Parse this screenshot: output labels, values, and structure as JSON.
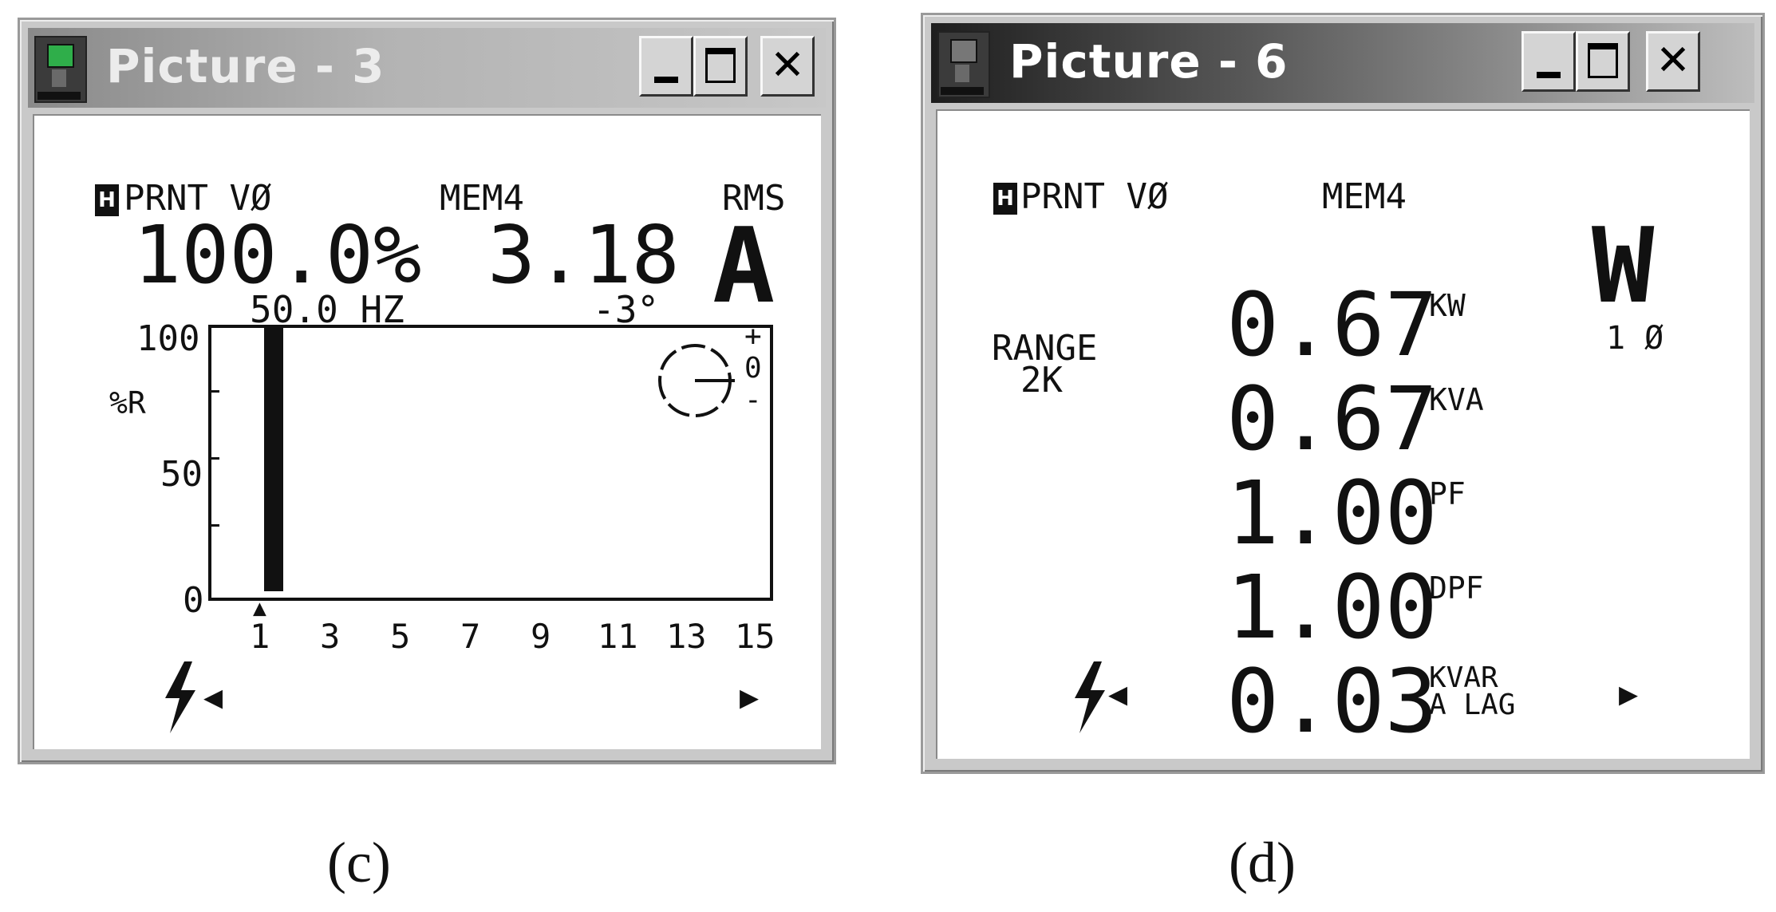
{
  "window_c": {
    "title": "Picture - 3",
    "hold_icon": "H",
    "header_left": "PRNT VØ",
    "header_mid": "MEM4",
    "header_right": "RMS",
    "big_percent": "100.0%",
    "big_value": "3.18",
    "big_unit": "A",
    "frequency": "50.0 HZ",
    "phase": "-3°",
    "y_axis_label": "%R",
    "y_ticks": [
      "100",
      "50",
      "0"
    ],
    "x_ticks": [
      "1",
      "3",
      "5",
      "7",
      "9",
      "11",
      "13",
      "15"
    ],
    "phase_plus": "+",
    "phase_zero": "0",
    "phase_minus": "-",
    "harmonic_levels_percent": [
      100
    ]
  },
  "window_d": {
    "title": "Picture - 6",
    "hold_icon": "H",
    "header_left": "PRNT VØ",
    "header_mid": "MEM4",
    "big_unit": "W",
    "phase_label": "1 Ø",
    "range_label": "RANGE",
    "range_value": "2K",
    "rows": [
      {
        "value": "0.67",
        "unit": "KW"
      },
      {
        "value": "0.67",
        "unit": "KVA"
      },
      {
        "value": "1.00",
        "unit": "PF"
      },
      {
        "value": "1.00",
        "unit": "DPF"
      },
      {
        "value": "0.03",
        "unit": "KVAR",
        "unit2": "A LAG"
      }
    ]
  },
  "captions": {
    "c": "(c)",
    "d": "(d)"
  },
  "icons": [
    "app-monitor-icon",
    "minimize-icon",
    "maximize-icon",
    "close-icon",
    "lightning-icon",
    "arrow-left-icon",
    "arrow-right-icon",
    "phasor-icon"
  ]
}
